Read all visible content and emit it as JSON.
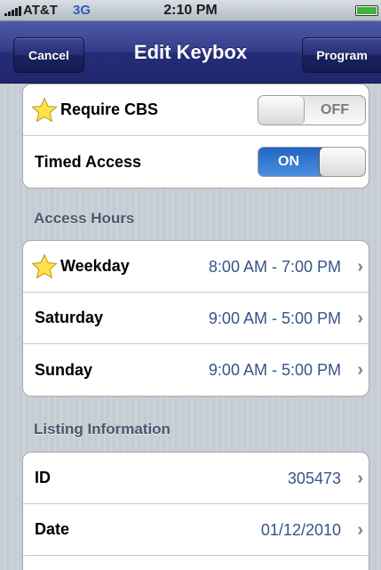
{
  "status_bar": {
    "carrier": "AT&T",
    "network": "3G",
    "time": "2:10 PM"
  },
  "nav": {
    "cancel_label": "Cancel",
    "title": "Edit Keybox",
    "program_label": "Program"
  },
  "settings": {
    "require_cbs": {
      "label": "Require CBS",
      "toggle": "OFF",
      "starred": true
    },
    "timed_access": {
      "label": "Timed Access",
      "toggle": "ON"
    }
  },
  "access_hours": {
    "header": "Access Hours",
    "rows": [
      {
        "label": "Weekday",
        "value": "8:00 AM - 7:00 PM",
        "starred": true
      },
      {
        "label": "Saturday",
        "value": "9:00 AM - 5:00 PM"
      },
      {
        "label": "Sunday",
        "value": "9:00 AM - 5:00 PM"
      }
    ]
  },
  "listing_information": {
    "header": "Listing Information",
    "rows": [
      {
        "label": "ID",
        "value": "305473"
      },
      {
        "label": "Date",
        "value": "01/12/2010"
      }
    ]
  },
  "colors": {
    "nav_bar": "#2a3280",
    "value_text": "#385487",
    "toggle_on": "#2f73d0",
    "section_header": "#4c566c"
  },
  "icons": {
    "star": "star-icon",
    "disclosure": "chevron-right-icon"
  }
}
